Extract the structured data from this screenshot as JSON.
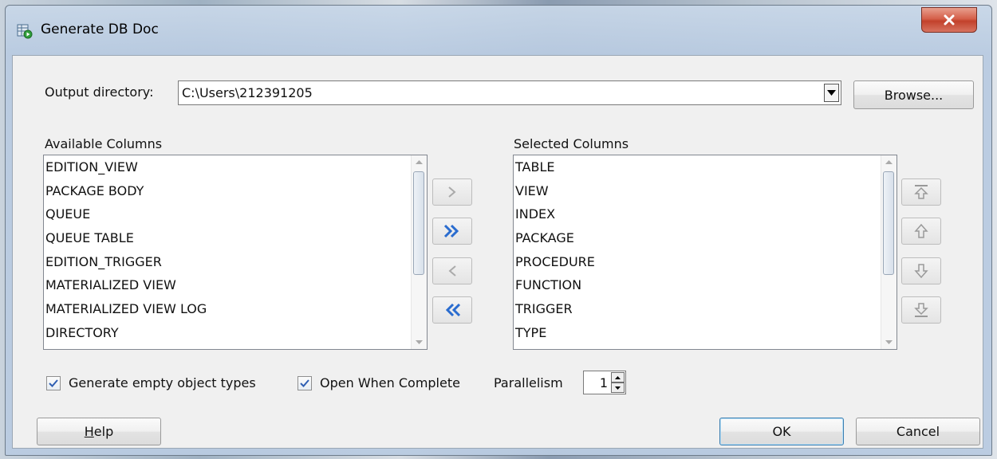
{
  "window": {
    "title": "Generate DB Doc",
    "close_icon": "close-icon"
  },
  "output": {
    "label": "Output directory:",
    "value": "C:\\Users\\212391205",
    "browse_label": "Browse..."
  },
  "available": {
    "header": "Available Columns",
    "items": [
      "EDITION_VIEW",
      "PACKAGE BODY",
      "QUEUE",
      "QUEUE TABLE",
      "EDITION_TRIGGER",
      "MATERIALIZED VIEW",
      "MATERIALIZED VIEW LOG",
      "DIRECTORY"
    ]
  },
  "selected": {
    "header": "Selected Columns",
    "items": [
      "TABLE",
      "VIEW",
      "INDEX",
      "PACKAGE",
      "PROCEDURE",
      "FUNCTION",
      "TRIGGER",
      "TYPE"
    ]
  },
  "options": {
    "generate_empty_label": "Generate empty object types",
    "generate_empty_checked": true,
    "open_when_complete_label": "Open When Complete",
    "open_when_complete_checked": true,
    "parallelism_label": "Parallelism",
    "parallelism_value": "1"
  },
  "buttons": {
    "help_label": "Help",
    "ok_label": "OK",
    "cancel_label": "Cancel"
  },
  "colors": {
    "accent_blue": "#2a6ccf",
    "close_red": "#c2412b",
    "check_blue": "#2f5fb3"
  }
}
